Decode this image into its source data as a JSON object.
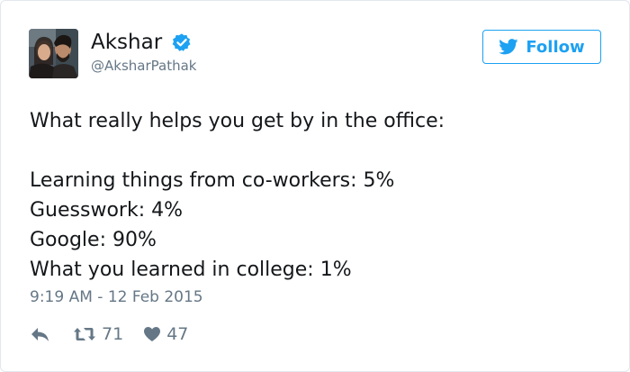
{
  "user": {
    "name": "Akshar",
    "handle": "@AksharPathak",
    "verified": true
  },
  "follow_button": {
    "label": "Follow",
    "icon": "twitter-bird-icon"
  },
  "tweet": {
    "lines": [
      "What really helps you get by in the office:",
      "",
      "Learning things from co-workers: 5%",
      "Guesswork: 4%",
      "Google: 90%",
      "What you learned in college: 1%"
    ],
    "timestamp": "9:19 AM - 12 Feb 2015"
  },
  "actions": {
    "reply": {
      "icon": "reply-icon"
    },
    "retweet": {
      "icon": "retweet-icon",
      "count": "71"
    },
    "like": {
      "icon": "heart-icon",
      "count": "47"
    }
  },
  "colors": {
    "accent": "#1da1f2",
    "text": "#14171a",
    "muted": "#657786",
    "border": "#e1e8ed"
  }
}
